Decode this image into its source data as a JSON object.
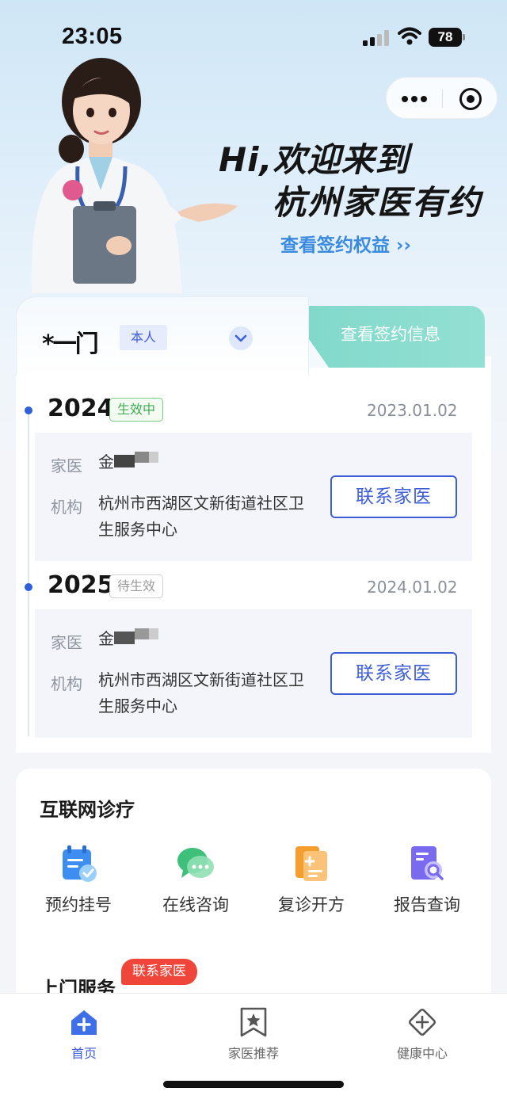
{
  "status_bar": {
    "time": "23:05",
    "battery": "78"
  },
  "hero": {
    "title_line1": "Hi,欢迎来到",
    "title_line2": "杭州家医有约",
    "link_label": "查看签约权益 ››"
  },
  "sign_card": {
    "name_masked": "*一门",
    "self_badge": "本人",
    "view_info_tab": "查看签约信息",
    "records": [
      {
        "year": "2024",
        "status": "生效中",
        "date": "2023.01.02",
        "doctor_label": "家医",
        "doctor_value": "金",
        "org_label": "机构",
        "org_value": "杭州市西湖区文新街道社区卫生服务中心",
        "contact_label": "联系家医"
      },
      {
        "year": "2025",
        "status": "待生效",
        "date": "2024.01.02",
        "doctor_label": "家医",
        "doctor_value": "金",
        "org_label": "机构",
        "org_value": "杭州市西湖区文新街道社区卫生服务中心",
        "contact_label": "联系家医"
      }
    ]
  },
  "internet_section": {
    "title": "互联网诊疗",
    "services": [
      {
        "label": "预约挂号",
        "icon": "calendar-check-icon"
      },
      {
        "label": "在线咨询",
        "icon": "chat-bubbles-icon"
      },
      {
        "label": "复诊开方",
        "icon": "prescription-icon"
      },
      {
        "label": "报告查询",
        "icon": "report-search-icon"
      }
    ]
  },
  "home_service": {
    "title": "上门服务",
    "badge": "联系家医"
  },
  "bottom_nav": {
    "items": [
      {
        "label": "首页",
        "icon": "home-plus-icon",
        "active": true
      },
      {
        "label": "家医推荐",
        "icon": "bookmark-star-icon",
        "active": false
      },
      {
        "label": "健康中心",
        "icon": "diamond-plus-icon",
        "active": false
      }
    ]
  },
  "colors": {
    "accent": "#3e5ed6",
    "teal_tab": "#7fd8c9",
    "active_green": "#3fae52",
    "badge_red": "#f0453a",
    "hero_link": "#3a8ae0"
  }
}
